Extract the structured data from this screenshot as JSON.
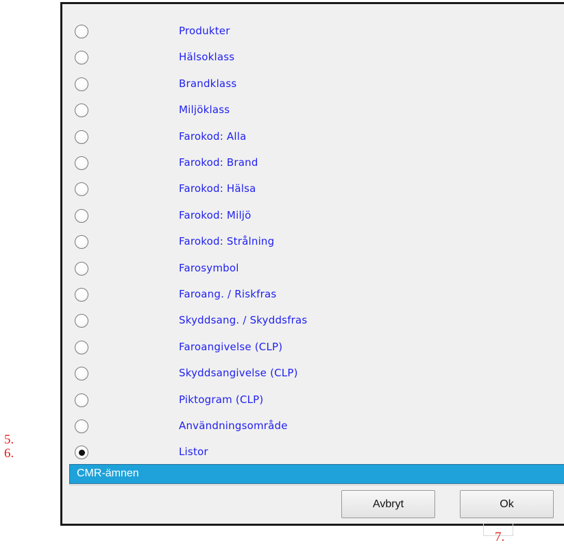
{
  "options": [
    {
      "label": "Produkter",
      "checked": false
    },
    {
      "label": "Hälsoklass",
      "checked": false
    },
    {
      "label": "Brandklass",
      "checked": false
    },
    {
      "label": "Miljöklass",
      "checked": false
    },
    {
      "label": "Farokod: Alla",
      "checked": false
    },
    {
      "label": "Farokod: Brand",
      "checked": false
    },
    {
      "label": "Farokod: Hälsa",
      "checked": false
    },
    {
      "label": "Farokod: Miljö",
      "checked": false
    },
    {
      "label": "Farokod: Strålning",
      "checked": false
    },
    {
      "label": "Farosymbol",
      "checked": false
    },
    {
      "label": "Faroang. / Riskfras",
      "checked": false
    },
    {
      "label": "Skyddsang. / Skyddsfras",
      "checked": false
    },
    {
      "label": "Faroangivelse (CLP)",
      "checked": false
    },
    {
      "label": "Skyddsangivelse (CLP)",
      "checked": false
    },
    {
      "label": "Piktogram (CLP)",
      "checked": false
    },
    {
      "label": "Användningsområde",
      "checked": false
    },
    {
      "label": "Listor",
      "checked": true
    }
  ],
  "list_select": {
    "value": "CMR-ämnen"
  },
  "buttons": {
    "cancel": "Avbryt",
    "ok": "Ok"
  },
  "annotations": {
    "a5": "5.",
    "a6": "6.",
    "a7": "7."
  },
  "colors": {
    "link": "#1f1ff0",
    "selection": "#1ea2d9",
    "annotation": "#e0201a"
  }
}
